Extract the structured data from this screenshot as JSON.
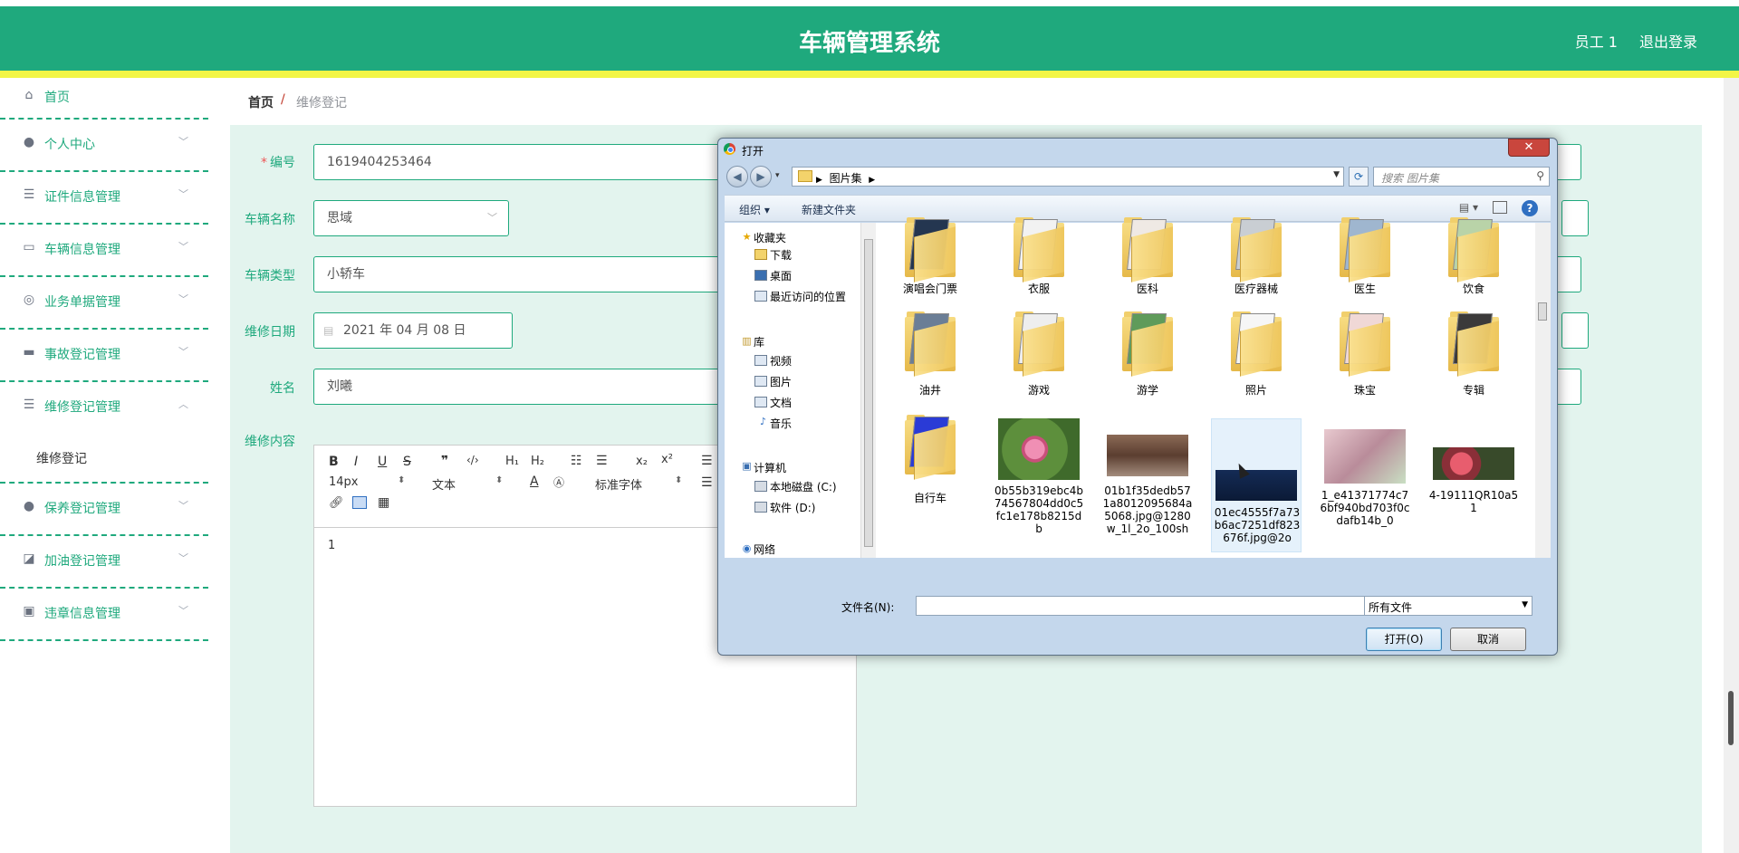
{
  "header": {
    "title": "车辆管理系统",
    "user": "员工 1",
    "logout": "退出登录",
    "brand_color": "#1fa97d",
    "accent_color": "#f2f546"
  },
  "sidebar": {
    "items": [
      {
        "label": "首页",
        "icon": "home-icon"
      },
      {
        "label": "个人中心",
        "icon": "user-icon"
      },
      {
        "label": "证件信息管理",
        "icon": "list-icon"
      },
      {
        "label": "车辆信息管理",
        "icon": "chat-icon"
      },
      {
        "label": "业务单据管理",
        "icon": "compass-icon"
      },
      {
        "label": "事故登记管理",
        "icon": "message-icon"
      },
      {
        "label": "维修登记管理",
        "icon": "list-icon"
      },
      {
        "label": "保养登记管理",
        "icon": "user-icon"
      },
      {
        "label": "加油登记管理",
        "icon": "chart-icon"
      },
      {
        "label": "违章信息管理",
        "icon": "clipboard-icon"
      }
    ],
    "submenu": "维修登记"
  },
  "breadcrumb": {
    "home": "首页",
    "separator": "/",
    "current": "维修登记"
  },
  "form": {
    "number_label": "编号",
    "number_value": "1619404253464",
    "name_label": "车辆名称",
    "name_value": "思域",
    "type_label": "车辆类型",
    "type_value": "小轿车",
    "date_label": "维修日期",
    "date_value": "2021 年 04 月 08 日",
    "person_label": "姓名",
    "person_value": "刘曦",
    "content_label": "维修内容"
  },
  "editor": {
    "font_size": "14px",
    "paragraph": "文本",
    "font_family": "标准字体",
    "content": "1"
  },
  "dialog": {
    "title": "打开",
    "path": "图片集",
    "search_placeholder": "搜索 图片集",
    "organize": "组织 ▾",
    "new_folder": "新建文件夹",
    "nav": {
      "favorites": "收藏夹",
      "downloads": "下载",
      "desktop": "桌面",
      "recent": "最近访问的位置",
      "libraries": "库",
      "videos": "视频",
      "pictures": "图片",
      "documents": "文档",
      "music": "音乐",
      "computer": "计算机",
      "disk_c": "本地磁盘 (C:)",
      "disk_d": "软件 (D:)",
      "network": "网络"
    },
    "files": [
      {
        "name": "演唱会门票"
      },
      {
        "name": "衣服"
      },
      {
        "name": "医科"
      },
      {
        "name": "医疗器械"
      },
      {
        "name": "医生"
      },
      {
        "name": "饮食"
      },
      {
        "name": "油井"
      },
      {
        "name": "游戏"
      },
      {
        "name": "游学"
      },
      {
        "name": "照片"
      },
      {
        "name": "珠宝"
      },
      {
        "name": "专辑"
      },
      {
        "name": "自行车"
      },
      {
        "name": "0b55b319ebc4b74567804dd0c5fc1e178b8215db"
      },
      {
        "name": "01b1f35dedb571a8012095684a5068.jpg@1280w_1l_2o_100sh"
      },
      {
        "name": "01ec4555f7a73b6ac7251df823676f.jpg@2o"
      },
      {
        "name": "1_e41371774c76bf940bd703f0cdafb14b_0"
      },
      {
        "name": "4-19111QR10a51"
      }
    ],
    "filename_label": "文件名(N):",
    "filename_value": "",
    "filetype": "所有文件",
    "open_button": "打开(O)",
    "cancel_button": "取消"
  }
}
